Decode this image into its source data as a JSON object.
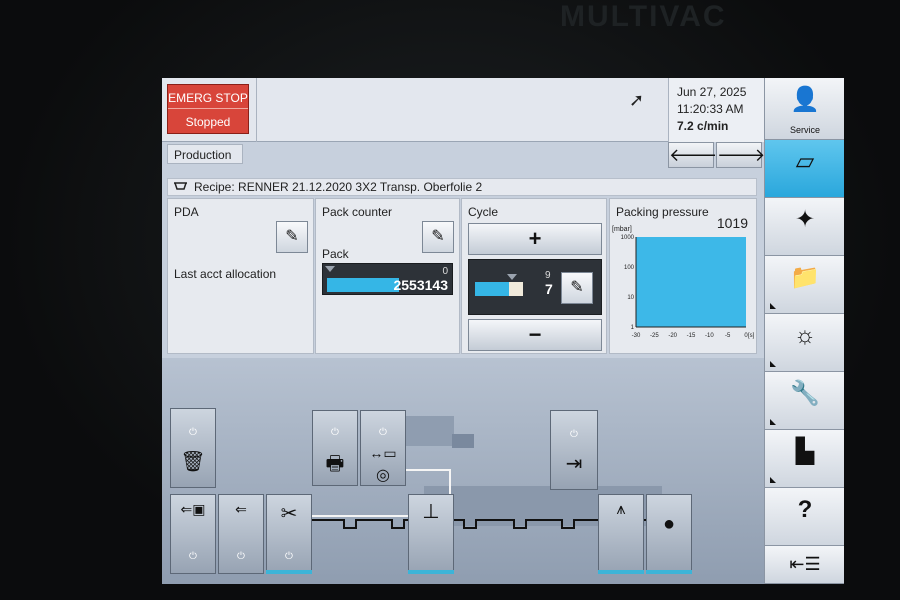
{
  "brand": "MULTIVAC",
  "header": {
    "estop_label": "EMERG STOP",
    "estop_state": "Stopped",
    "date": "Jun 27, 2025",
    "time": "11:20:33 AM",
    "rate": "7.2 c/min"
  },
  "nav": {
    "tab_label": "Production",
    "back_glyph": "🡐",
    "forward_glyph": "🡒"
  },
  "recipe": {
    "text": "Recipe: RENNER 21.12.2020 3X2 Transp. Oberfolie 2"
  },
  "panels": {
    "pda": {
      "title": "PDA",
      "note": "Last acct allocation"
    },
    "pack_counter": {
      "title": "Pack counter",
      "label": "Pack",
      "zero": "0",
      "value": "2553143"
    },
    "cycle": {
      "title": "Cycle",
      "plus": "+",
      "minus": "−",
      "top_value": "9",
      "current_value": "7"
    },
    "packing_pressure": {
      "title": "Packing pressure",
      "value": "1019",
      "unit": "[mbar]",
      "x_unit": "[s]"
    }
  },
  "chart_data": {
    "type": "area",
    "title": "Packing pressure",
    "ylabel": "[mbar]",
    "xlabel": "[s]",
    "y_scale": "log",
    "y_ticks": [
      "1000",
      "100",
      "10",
      "1"
    ],
    "x_ticks": [
      "-30",
      "-25",
      "-20",
      "-15",
      "-10",
      "-5",
      "0"
    ],
    "ylim": [
      1,
      1000
    ],
    "xlim": [
      -30,
      0
    ],
    "x": [
      -30,
      0
    ],
    "values": [
      1000,
      1000
    ],
    "color": "#3db8e8"
  },
  "sidebar": {
    "service_label": "Service",
    "icons": [
      "service-icon",
      "production-icon",
      "magic-wand-icon",
      "folder-icon",
      "settings-icon",
      "wrench-icon",
      "statistics-icon",
      "help-icon",
      "menu-icon"
    ],
    "help_glyph": "?"
  },
  "machine": {
    "power_glyph": "⏻"
  }
}
